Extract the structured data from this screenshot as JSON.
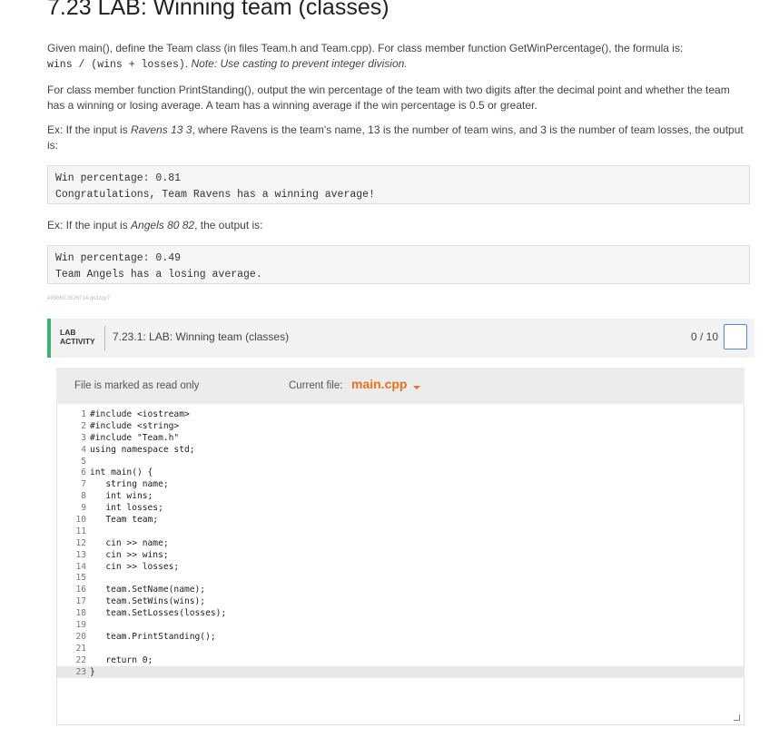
{
  "page": {
    "title": "7.23 LAB: Winning team (classes)",
    "p1_text": "Given main(), define the Team class (in files Team.h and Team.cpp). For class member function GetWinPercentage(), the formula is:",
    "p1_formula": "wins / (wins + losses)",
    "p1_note": "Note: Use casting to prevent integer division.",
    "p2": "For class member function PrintStanding(), output the win percentage of the team with two digits after the decimal point and whether the team has a winning or losing average. A team has a winning average if the win percentage is 0.5 or greater.",
    "p3_a": "Ex: If the input is ",
    "p3_input": "Ravens 13 3",
    "p3_b": ", where Ravens is the team's name, 13 is the number of team wins, and 3 is the number of team losses, the output is:",
    "ex1_line1": "Win percentage: 0.81",
    "ex1_line2": "Congratulations, Team Ravens has a winning average!",
    "p4_a": "Ex: If the input is ",
    "p4_input": "Angels 80 82",
    "p4_b": ", the output is:",
    "ex2_line1": "Win percentage: 0.49",
    "ex2_line2": "Team Angels has a losing average.",
    "small_id": "499680.3526714.qx3zqy7"
  },
  "lab": {
    "tag_line1": "LAB",
    "tag_line2": "ACTIVITY",
    "title": "7.23.1: LAB: Winning team (classes)",
    "score": "0 / 10"
  },
  "editor": {
    "readonly_label": "File is marked as read only",
    "current_file_label": "Current file:",
    "current_file": "main.cpp",
    "line_numbers": [
      "1",
      "2",
      "3",
      "4",
      "5",
      "6",
      "7",
      "8",
      "9",
      "10",
      "11",
      "12",
      "13",
      "14",
      "15",
      "16",
      "17",
      "18",
      "19",
      "20",
      "21",
      "22",
      "23"
    ],
    "code_lines": [
      "#include <iostream>",
      "#include <string>",
      "#include \"Team.h\"",
      "using namespace std;",
      "",
      "int main() {",
      "   string name;",
      "   int wins;",
      "   int losses;",
      "   Team team;",
      "",
      "   cin >> name;",
      "   cin >> wins;",
      "   cin >> losses;",
      "",
      "   team.SetName(name);",
      "   team.SetWins(wins);",
      "   team.SetLosses(losses);",
      "",
      "   team.PrintStanding();",
      "",
      "   return 0;",
      "}"
    ]
  }
}
